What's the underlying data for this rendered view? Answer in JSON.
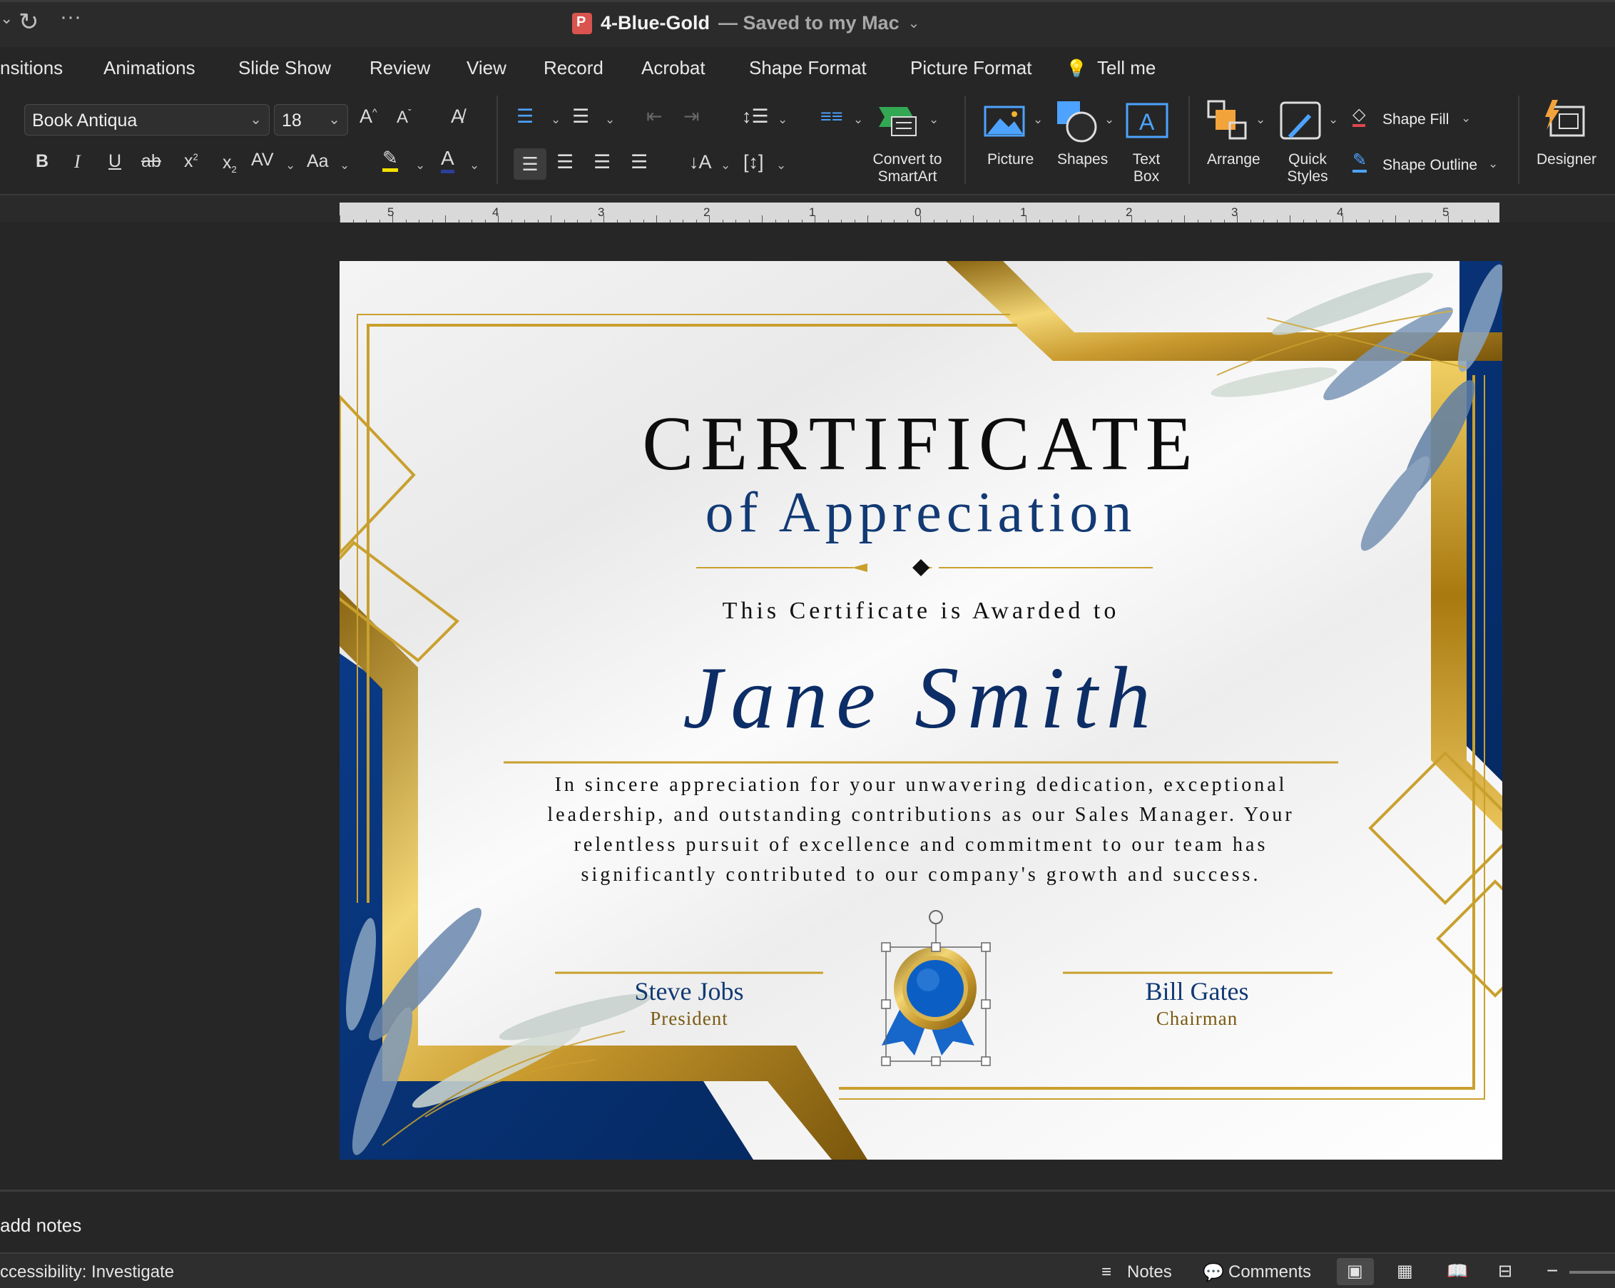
{
  "titlebar": {
    "doc_name": "4-Blue-Gold",
    "status": "— Saved to my Mac",
    "more_label": "···"
  },
  "tabs": [
    "nsitions",
    "Animations",
    "Slide Show",
    "Review",
    "View",
    "Record",
    "Acrobat",
    "Shape Format",
    "Picture Format",
    "Tell me"
  ],
  "ribbon": {
    "font_name": "Book Antiqua",
    "font_size": "18",
    "bold": "B",
    "italic": "I",
    "underline": "U",
    "strike": "ab",
    "superscript": "x",
    "subscript": "x",
    "char_spacing": "AV",
    "change_case": "Aa",
    "grow_font": "A",
    "shrink_font": "A",
    "convert_smartart": "Convert to\nSmartArt",
    "picture": "Picture",
    "shapes": "Shapes",
    "textbox": "Text\nBox",
    "arrange": "Arrange",
    "quick_styles": "Quick\nStyles",
    "shape_fill": "Shape Fill",
    "shape_outline": "Shape Outline",
    "designer": "Designer"
  },
  "ruler": {
    "labels": [
      "5",
      "4",
      "3",
      "2",
      "1",
      "0",
      "1",
      "2",
      "3",
      "4",
      "5"
    ]
  },
  "certificate": {
    "title": "CERTIFICATE",
    "subtitle": "of Appreciation",
    "awarded_to": "This Certificate is Awarded to",
    "recipient": "Jane Smith",
    "body": "In sincere appreciation for your unwavering dedication, exceptional leadership, and outstanding contributions as our Sales Manager. Your relentless pursuit of excellence and commitment to our team has significantly contributed to our company's growth and success.",
    "signer1_name": "Steve Jobs",
    "signer1_role": "President",
    "signer2_name": "Bill Gates",
    "signer2_role": "Chairman",
    "colors": {
      "navy": "#0b3577",
      "gold": "#c9a02e",
      "text_blue": "#123a74"
    }
  },
  "notes": {
    "hint": "add notes"
  },
  "status": {
    "accessibility": "ccessibility: Investigate",
    "notes": "Notes",
    "comments": "Comments"
  }
}
